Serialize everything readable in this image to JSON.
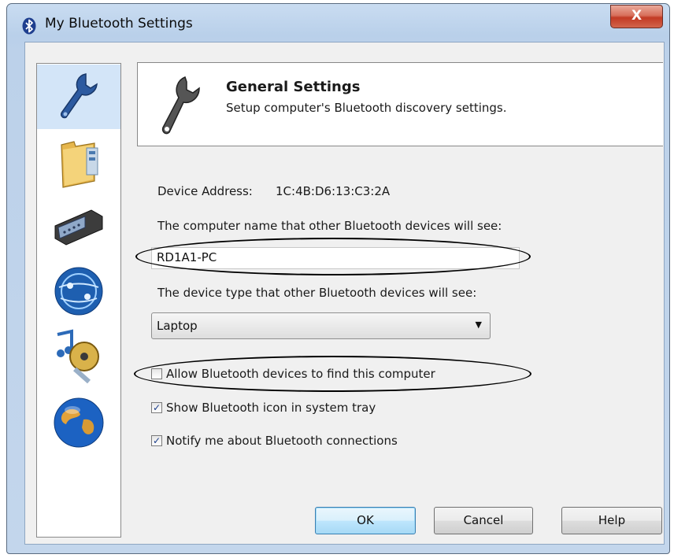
{
  "window": {
    "title": "My Bluetooth Settings",
    "close_label": "X"
  },
  "sidebar": {
    "items": [
      {
        "icon": "wrench-icon",
        "active": true
      },
      {
        "icon": "folder-icon",
        "active": false
      },
      {
        "icon": "serial-port-icon",
        "active": false
      },
      {
        "icon": "network-globe-icon",
        "active": false
      },
      {
        "icon": "music-film-icon",
        "active": false
      },
      {
        "icon": "earth-globe-icon",
        "active": false
      }
    ]
  },
  "header": {
    "icon": "wrench-icon",
    "title": "General Settings",
    "subtitle": "Setup computer's Bluetooth discovery settings."
  },
  "form": {
    "device_address_label": "Device Address:",
    "device_address_value": "1C:4B:D6:13:C3:2A",
    "computer_name_label": "The computer name that other Bluetooth devices will see:",
    "computer_name_value": "RD1A1-PC",
    "device_type_label": "The device type that other Bluetooth devices will see:",
    "device_type_value": "Laptop"
  },
  "options": [
    {
      "label": "Allow Bluetooth devices to find this computer",
      "checked": false
    },
    {
      "label": "Show Bluetooth icon in system tray",
      "checked": true
    },
    {
      "label": "Notify me about Bluetooth connections",
      "checked": true
    }
  ],
  "buttons": {
    "ok": "OK",
    "cancel": "Cancel",
    "help": "Help"
  },
  "colors": {
    "accent": "#3c7fb1",
    "close": "#c23a24",
    "active_item": "#d3e5f8"
  }
}
